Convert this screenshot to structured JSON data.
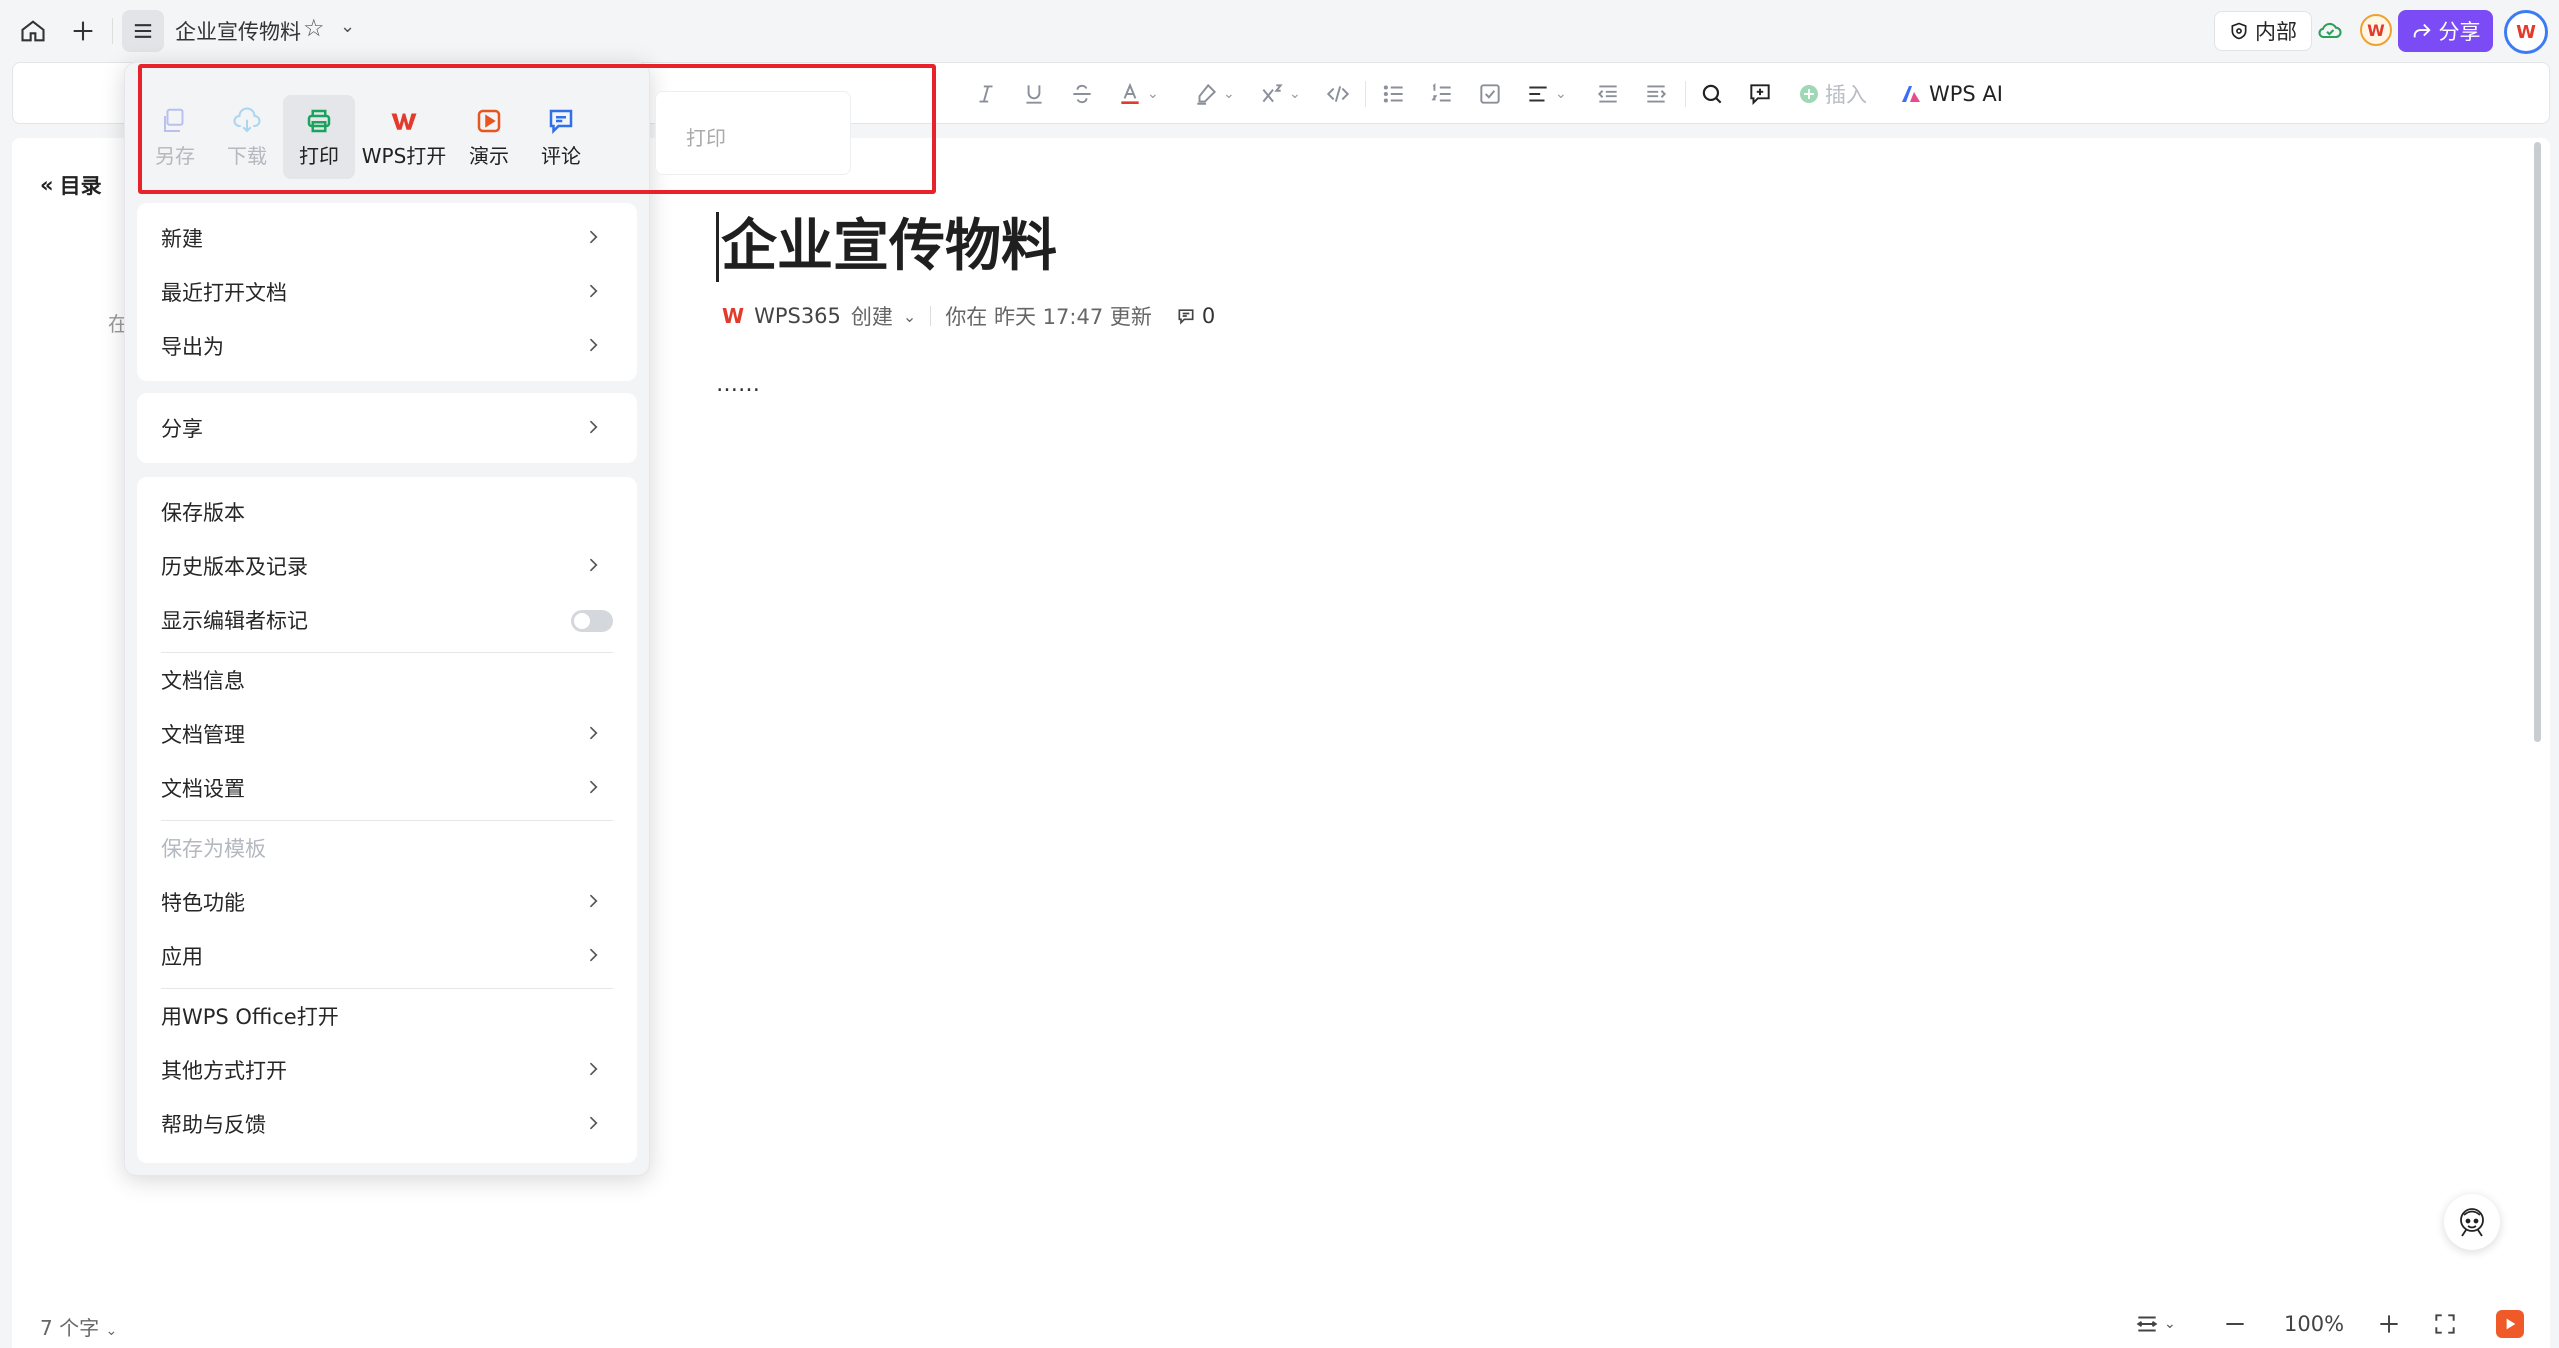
{
  "tab": {
    "title": "企业宣传物料"
  },
  "header": {
    "internal_label": "内部",
    "share_label": "分享",
    "wps_badge": "W",
    "avatar_initial": "W"
  },
  "toolbar": {
    "insert_label": "插入",
    "wps_ai_label": "WPS AI"
  },
  "document": {
    "toc_label": "目录",
    "toc_hint": "在",
    "title": "企业宣传物料",
    "author_logo": "W",
    "author": "WPS365",
    "created_label": "创建",
    "updated_text": "你在 昨天 17:47 更新",
    "comment_count": "0",
    "body": "……"
  },
  "footer": {
    "word_count": "7 个字",
    "zoom": "100%"
  },
  "menu": {
    "quick_actions": [
      {
        "label": "另存",
        "state": "disabled",
        "icon": "save-as-icon"
      },
      {
        "label": "下载",
        "state": "disabled",
        "icon": "download-icon"
      },
      {
        "label": "打印",
        "state": "hover",
        "icon": "print-icon"
      },
      {
        "label": "WPS打开",
        "state": "normal",
        "icon": "wps-logo-icon"
      },
      {
        "label": "演示",
        "state": "normal",
        "icon": "present-icon"
      },
      {
        "label": "评论",
        "state": "normal",
        "icon": "comment-icon"
      }
    ],
    "tooltip": "打印",
    "group1": [
      "新建",
      "最近打开文档",
      "导出为"
    ],
    "group2": [
      "分享"
    ],
    "group3": [
      "保存版本",
      "历史版本及记录",
      "显示编辑者标记",
      "文档信息",
      "文档管理",
      "文档设置",
      "保存为模板",
      "特色功能",
      "应用",
      "用WPS Office打开",
      "其他方式打开",
      "帮助与反馈"
    ]
  },
  "colors": {
    "accent_purple": "#7b4cf5",
    "wps_red": "#e23b2e",
    "highlight_red": "#e8222b",
    "print_green": "#1aa35c",
    "present_orange": "#e8561f",
    "comment_blue": "#2f6fe8"
  }
}
